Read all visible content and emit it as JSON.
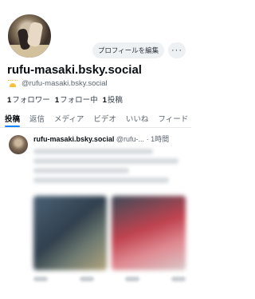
{
  "profile": {
    "display_name": "rufu-masaki.bsky.social",
    "handle": "@rufu-masaki.bsky.social",
    "edit_button": "プロフィールを編集",
    "more_button": "···",
    "stats": {
      "followers_count": "1",
      "followers_label": "フォロワー",
      "following_count": "1",
      "following_label": "フォロー中",
      "posts_count": "1",
      "posts_label": "投稿"
    }
  },
  "tabs": [
    "投稿",
    "返信",
    "メディア",
    "ビデオ",
    "いいね",
    "フィード"
  ],
  "active_tab": "投稿",
  "post": {
    "author": "rufu-masaki.bsky.social",
    "handle_truncated": "@rufu-...",
    "time": "· 1時間"
  },
  "colors": {
    "accent": "#1083fe",
    "button_bg": "#eef1f4",
    "muted_text": "#5c6670"
  }
}
